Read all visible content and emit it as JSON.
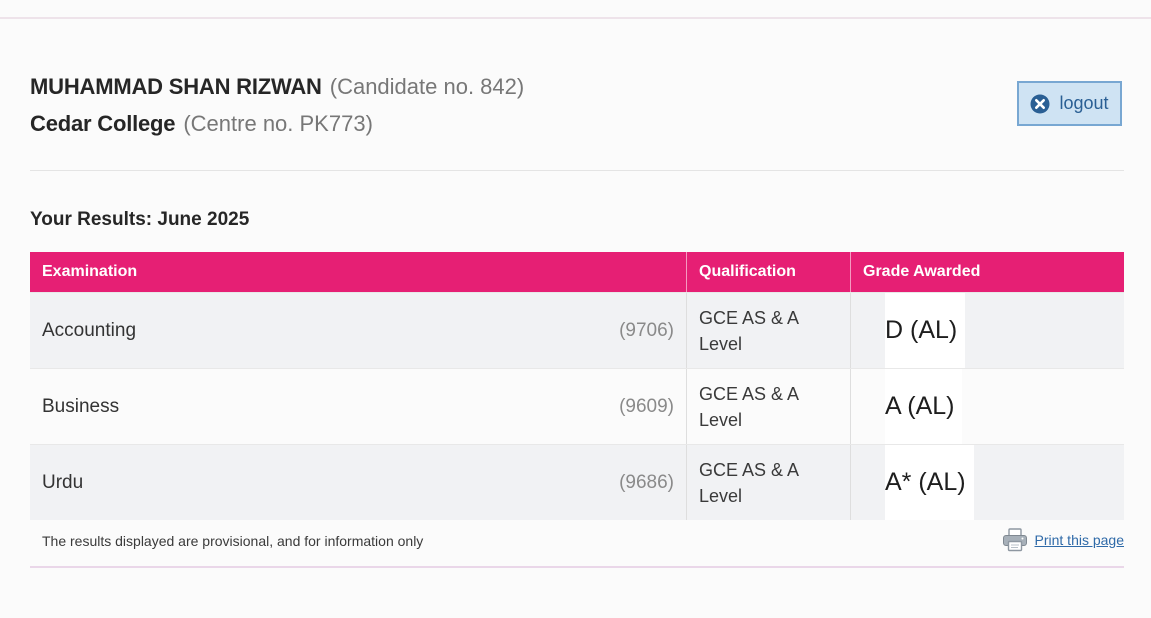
{
  "candidate": {
    "name": "MUHAMMAD SHAN RIZWAN",
    "number": "(Candidate no. 842)"
  },
  "centre": {
    "name": "Cedar College",
    "number": "(Centre no. PK773)"
  },
  "logout": {
    "label": "logout",
    "icon": "close-circle-icon"
  },
  "results": {
    "heading": "Your Results: June 2025",
    "columns": [
      "Examination",
      "Qualification",
      "Grade Awarded"
    ],
    "rows": [
      {
        "subject": "Accounting",
        "code": "(9706)",
        "qualification": "GCE AS & A Level",
        "grade": "D (AL)"
      },
      {
        "subject": "Business",
        "code": "(9609)",
        "qualification": "GCE AS & A Level",
        "grade": "A (AL)"
      },
      {
        "subject": "Urdu",
        "code": "(9686)",
        "qualification": "GCE AS & A Level",
        "grade": "A* (AL)"
      }
    ]
  },
  "footer": {
    "note": "The results displayed are provisional, and for information only",
    "print_label": "Print this page",
    "print_icon": "printer-icon"
  },
  "colors": {
    "header_bg": "#e61f74",
    "link": "#2f6aa8",
    "logout_bg": "#cfe3f3",
    "logout_border": "#78a7d2"
  }
}
